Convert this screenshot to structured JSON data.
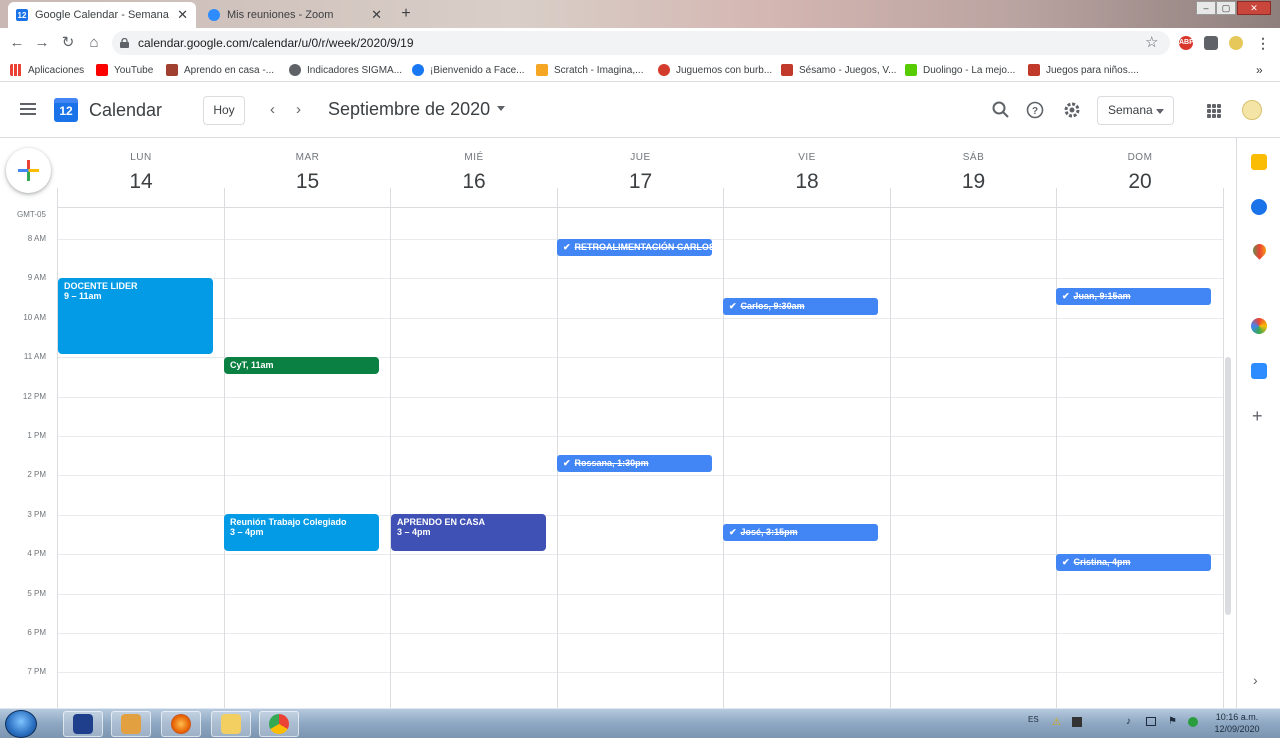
{
  "browser": {
    "tabs": [
      {
        "title": "Google Calendar - Semana del 1...",
        "active": true
      },
      {
        "title": "Mis reuniones - Zoom",
        "active": false
      }
    ],
    "new_tab": "+",
    "url": "calendar.google.com/calendar/u/0/r/week/2020/9/19",
    "window_controls": [
      "–",
      "▢",
      "✕"
    ],
    "extensions": [
      "ABP"
    ],
    "bookmarks": [
      {
        "label": "Aplicaciones",
        "color": "#5f6368"
      },
      {
        "label": "YouTube",
        "color": "#ff0000"
      },
      {
        "label": "Aprendo en casa -...",
        "color": "#a04030"
      },
      {
        "label": "Indicadores SIGMA...",
        "color": "#5f6368"
      },
      {
        "label": "¡Bienvenido a Face...",
        "color": "#1877f2"
      },
      {
        "label": "Scratch - Imagina,...",
        "color": "#f5a623"
      },
      {
        "label": "Juguemos con burb...",
        "color": "#d33b2c"
      },
      {
        "label": "Sésamo - Juegos, V...",
        "color": "#c0392b"
      },
      {
        "label": "Duolingo - La mejo...",
        "color": "#58cc02"
      },
      {
        "label": "Juegos para niños....",
        "color": "#c0392b"
      }
    ]
  },
  "header": {
    "logo_day": "12",
    "app_title": "Calendar",
    "today_label": "Hoy",
    "prev": "‹",
    "next": "›",
    "month_title": "Septiembre de 2020",
    "view_label": "Semana"
  },
  "timezone": "GMT-05",
  "days": [
    {
      "dow": "LUN",
      "num": "14"
    },
    {
      "dow": "MAR",
      "num": "15"
    },
    {
      "dow": "MIÉ",
      "num": "16"
    },
    {
      "dow": "JUE",
      "num": "17"
    },
    {
      "dow": "VIE",
      "num": "18"
    },
    {
      "dow": "SÁB",
      "num": "19"
    },
    {
      "dow": "DOM",
      "num": "20"
    }
  ],
  "hours": [
    "8 AM",
    "9 AM",
    "10 AM",
    "11 AM",
    "12 PM",
    "1 PM",
    "2 PM",
    "3 PM",
    "4 PM",
    "5 PM",
    "6 PM",
    "7 PM"
  ],
  "events": [
    {
      "title": "DOCENTE LIDER",
      "time": "9 – 11am",
      "color": "#039be5"
    },
    {
      "title": "CyT, 11am",
      "time": "",
      "color": "#0b8043"
    },
    {
      "title": "Reunión Trabajo Colegiado",
      "time": "3 – 4pm",
      "color": "#039be5"
    },
    {
      "title": "APRENDO EN CASA",
      "time": "3 – 4pm",
      "color": "#3f51b5"
    }
  ],
  "tasks": [
    {
      "title": "RETROALIMENTACIÓN CARLOS"
    },
    {
      "title": "Carlos, 9:30am"
    },
    {
      "title": "Juan, 9:15am"
    },
    {
      "title": "Rossana, 1:30pm"
    },
    {
      "title": "José, 3:15pm"
    },
    {
      "title": "Cristina, 4pm"
    }
  ],
  "taskbar": {
    "language": "ES",
    "time": "10:16 a.m.",
    "date": "12/09/2020"
  }
}
